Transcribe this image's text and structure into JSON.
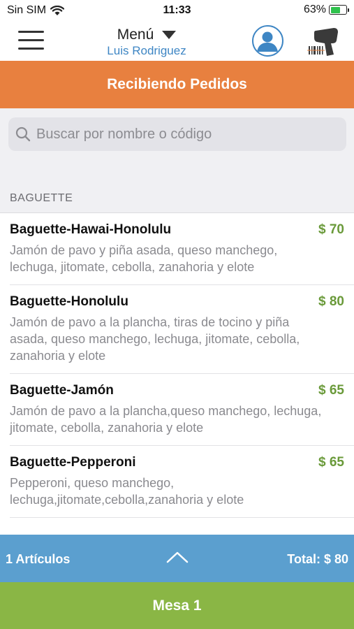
{
  "status": {
    "carrier": "Sin SIM",
    "time": "11:33",
    "battery": "63%",
    "battery_level": 0.63
  },
  "nav": {
    "title": "Menú",
    "subtitle": "Luis Rodriguez",
    "menu_icon": "hamburger-icon",
    "profile_icon": "user-avatar-icon",
    "scanner_icon": "barcode-scanner-icon"
  },
  "banner": {
    "label": "Recibiendo Pedidos",
    "color": "#e8803f"
  },
  "search": {
    "placeholder": "Buscar por nombre o código",
    "value": ""
  },
  "section": {
    "title": "BAGUETTE"
  },
  "products": [
    {
      "name": "Baguette-Hawai-Honolulu",
      "price": "$ 70",
      "description": "Jamón de pavo y piña asada, queso manchego, lechuga, jitomate, cebolla, zanahoria y elote"
    },
    {
      "name": "Baguette-Honolulu",
      "price": "$ 80",
      "description": "Jamón de pavo a la plancha, tiras de tocino y piña asada, queso manchego, lechuga, jitomate, cebolla, zanahoria y elote"
    },
    {
      "name": "Baguette-Jamón",
      "price": "$ 65",
      "description": "Jamón de pavo a la plancha,queso manchego, lechuga, jitomate, cebolla, zanahoria y elote"
    },
    {
      "name": "Baguette-Pepperoni",
      "price": "$ 65",
      "description": "Pepperoni, queso manchego, lechuga,jitomate,cebolla,zanahoria y elote"
    }
  ],
  "cart": {
    "items_label": "1 Artículos",
    "total_label": "Total: $ 80",
    "expand_icon": "chevron-up-icon",
    "color": "#5b9fcf"
  },
  "table": {
    "label": "Mesa 1",
    "color": "#8ab645"
  },
  "colors": {
    "accent_blue": "#3e86c4",
    "price_green": "#6a9a3a"
  }
}
